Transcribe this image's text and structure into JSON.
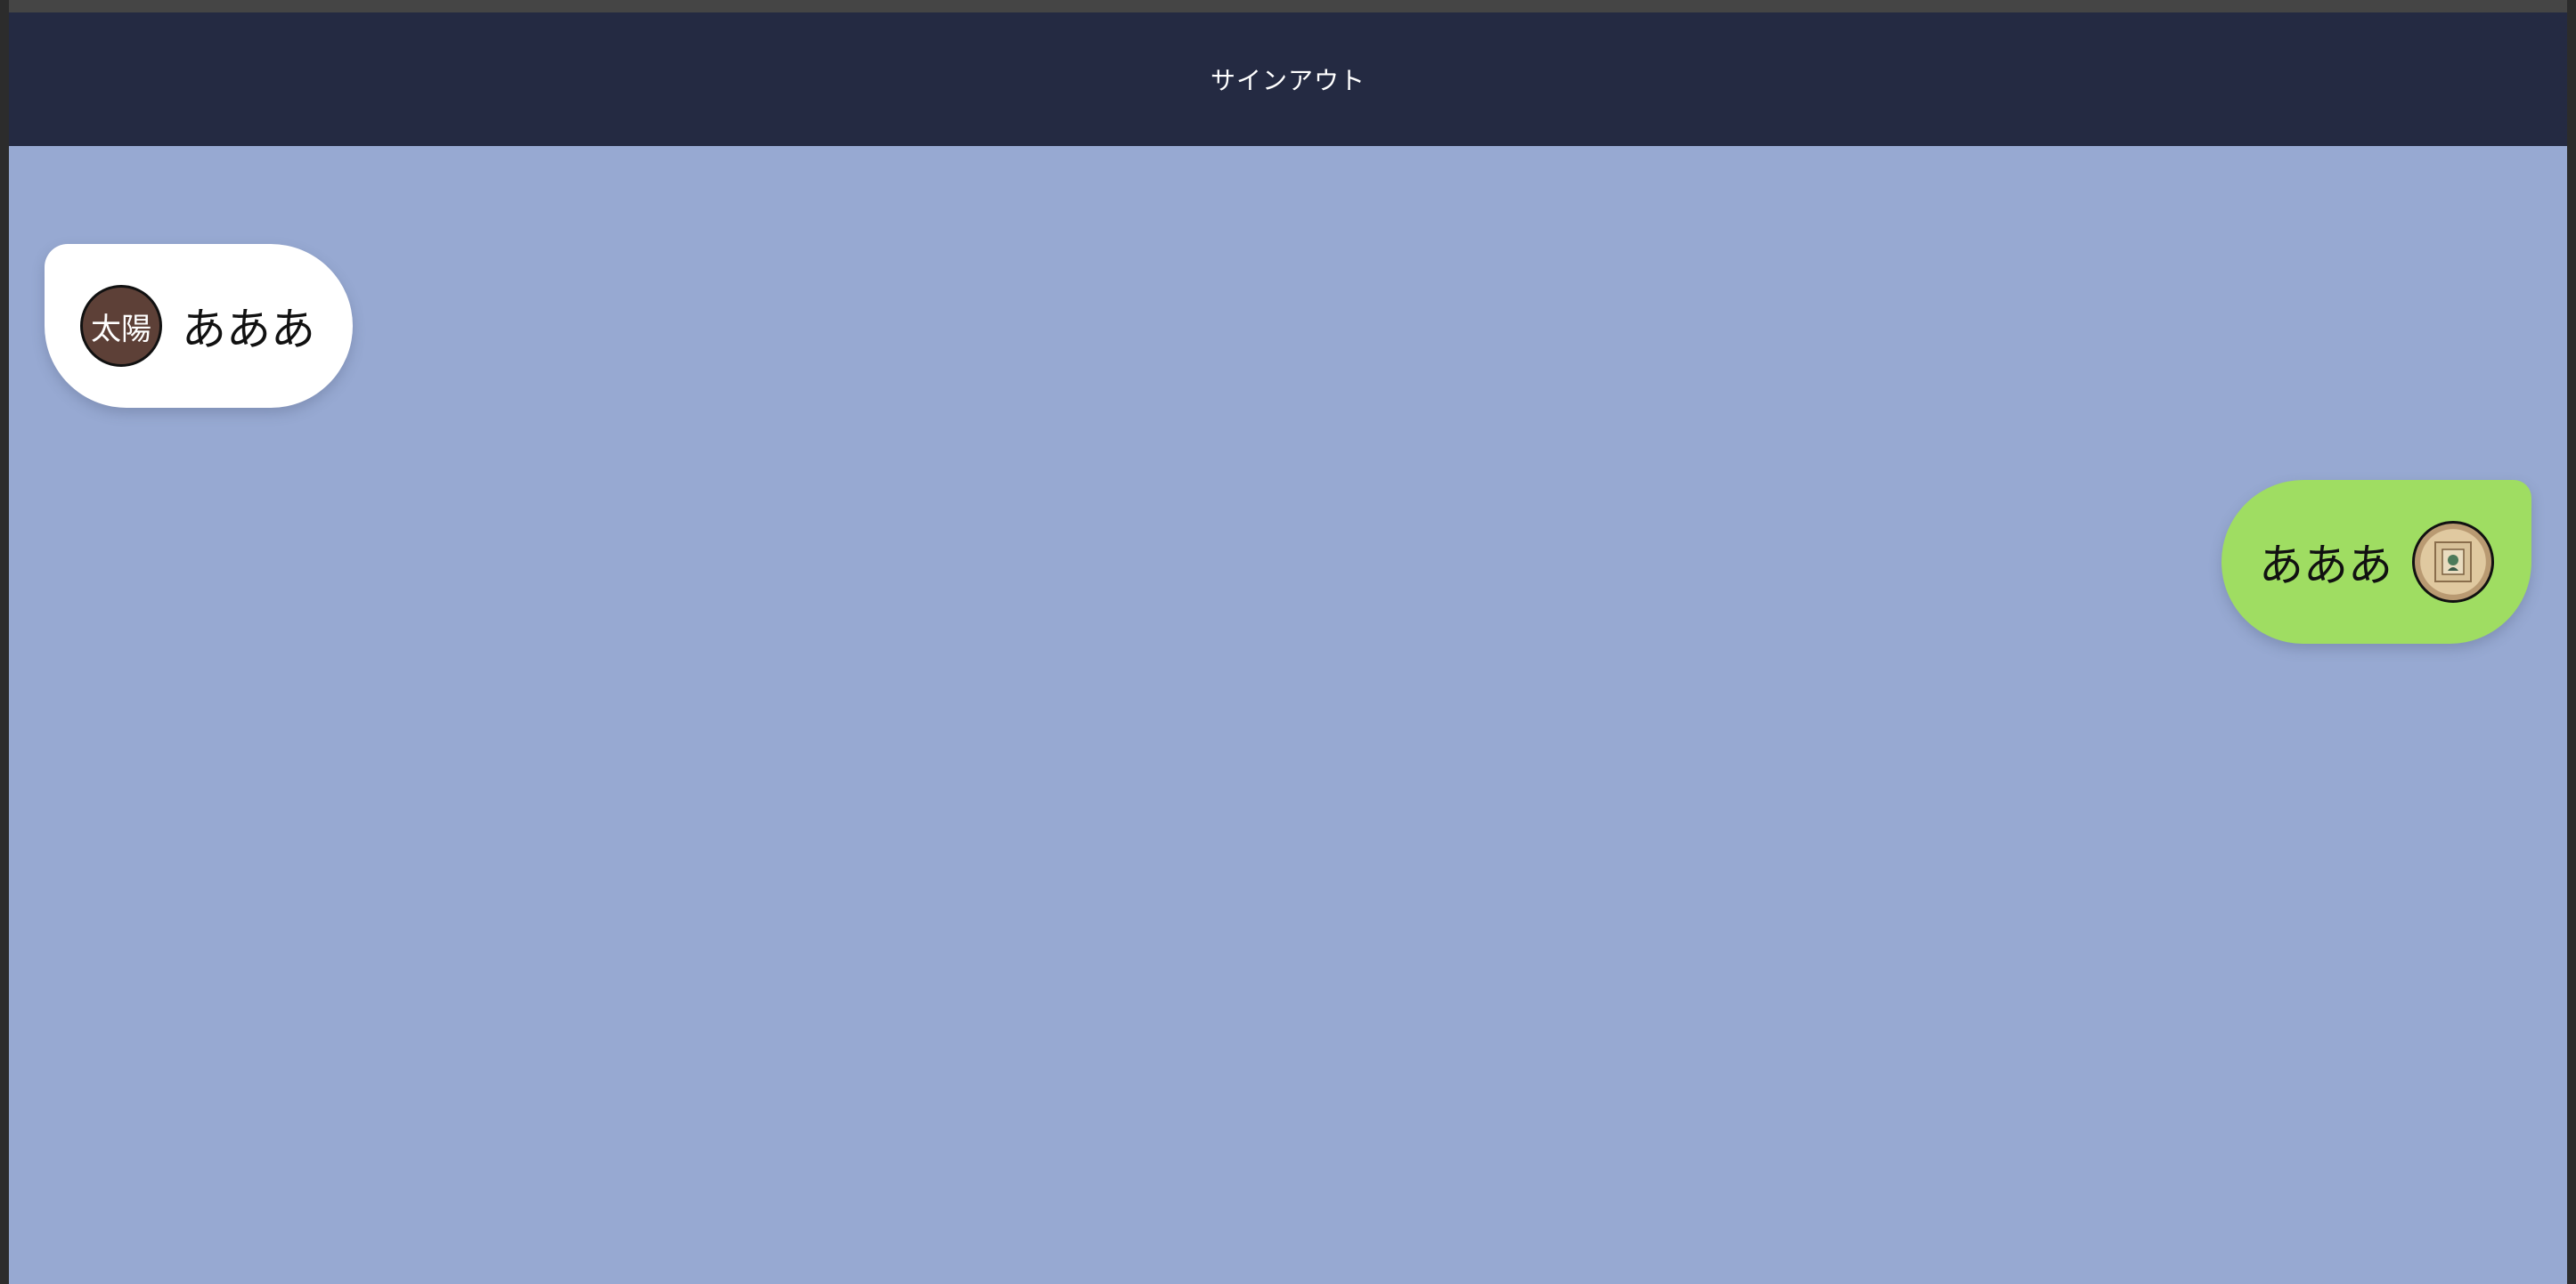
{
  "header": {
    "signout_label": "サインアウト"
  },
  "messages": [
    {
      "side": "left",
      "avatar_text": "太陽",
      "text": "あああ"
    },
    {
      "side": "right",
      "avatar_icon": "user-photo-avatar",
      "text": "あああ"
    }
  ],
  "colors": {
    "header_bg": "#242a42",
    "chat_bg": "#97a9d2",
    "incoming_bubble": "#ffffff",
    "outgoing_bubble": "#9fdd62",
    "avatar_bg": "#5d4037"
  }
}
